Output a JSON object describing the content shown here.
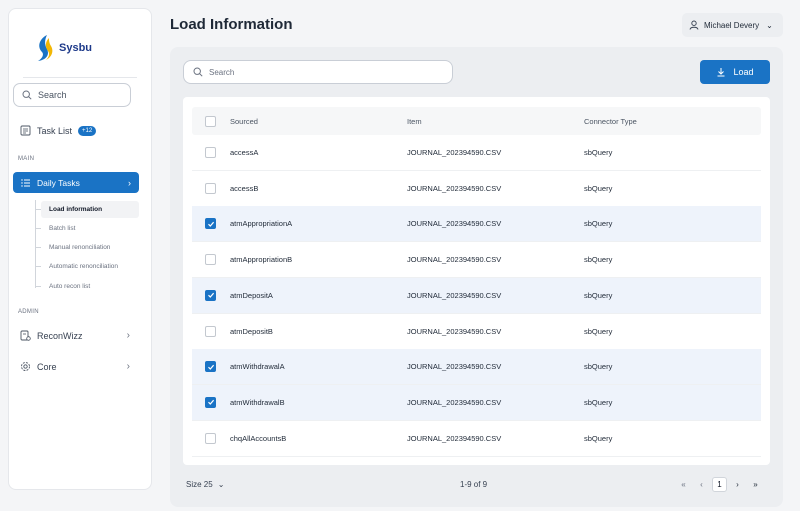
{
  "brand": {
    "name": "Sysbu"
  },
  "sidebar": {
    "search_label": "Search",
    "task_list": {
      "label": "Task List",
      "badge": "+12"
    },
    "main_label": "MAIN",
    "daily_tasks": "Daily Tasks",
    "subitems": [
      {
        "label": "Load information",
        "active": true
      },
      {
        "label": "Batch list",
        "active": false
      },
      {
        "label": "Manual renonciliation",
        "active": false
      },
      {
        "label": "Automatic renonciliation",
        "active": false
      },
      {
        "label": "Auto recon list",
        "active": false
      }
    ],
    "admin_label": "ADMIN",
    "reconwizz": "ReconWizz",
    "core": "Core"
  },
  "header": {
    "title": "Load Information",
    "user": "Michael Devery"
  },
  "toolbar": {
    "search_placeholder": "Search",
    "load_label": "Load"
  },
  "table": {
    "columns": [
      "Sourced",
      "Item",
      "Connector Type"
    ],
    "rows": [
      {
        "sourced": "accessA",
        "item": "JOURNAL_202394590.CSV",
        "connector": "sbQuery",
        "selected": false
      },
      {
        "sourced": "accessB",
        "item": "JOURNAL_202394590.CSV",
        "connector": "sbQuery",
        "selected": false
      },
      {
        "sourced": "atmAppropriationA",
        "item": "JOURNAL_202394590.CSV",
        "connector": "sbQuery",
        "selected": true
      },
      {
        "sourced": "atmAppropriationB",
        "item": "JOURNAL_202394590.CSV",
        "connector": "sbQuery",
        "selected": false
      },
      {
        "sourced": "atmDepositA",
        "item": "JOURNAL_202394590.CSV",
        "connector": "sbQuery",
        "selected": true
      },
      {
        "sourced": "atmDepositB",
        "item": "JOURNAL_202394590.CSV",
        "connector": "sbQuery",
        "selected": false
      },
      {
        "sourced": "atmWithdrawalA",
        "item": "JOURNAL_202394590.CSV",
        "connector": "sbQuery",
        "selected": true
      },
      {
        "sourced": "atmWithdrawalB",
        "item": "JOURNAL_202394590.CSV",
        "connector": "sbQuery",
        "selected": true
      },
      {
        "sourced": "chqAllAccountsB",
        "item": "JOURNAL_202394590.CSV",
        "connector": "sbQuery",
        "selected": false
      }
    ]
  },
  "footer": {
    "size_label": "Size 25",
    "count": "1-9 of 9",
    "current_page": "1"
  },
  "colors": {
    "accent": "#1a73c5",
    "selected_row": "#eef3fb"
  }
}
